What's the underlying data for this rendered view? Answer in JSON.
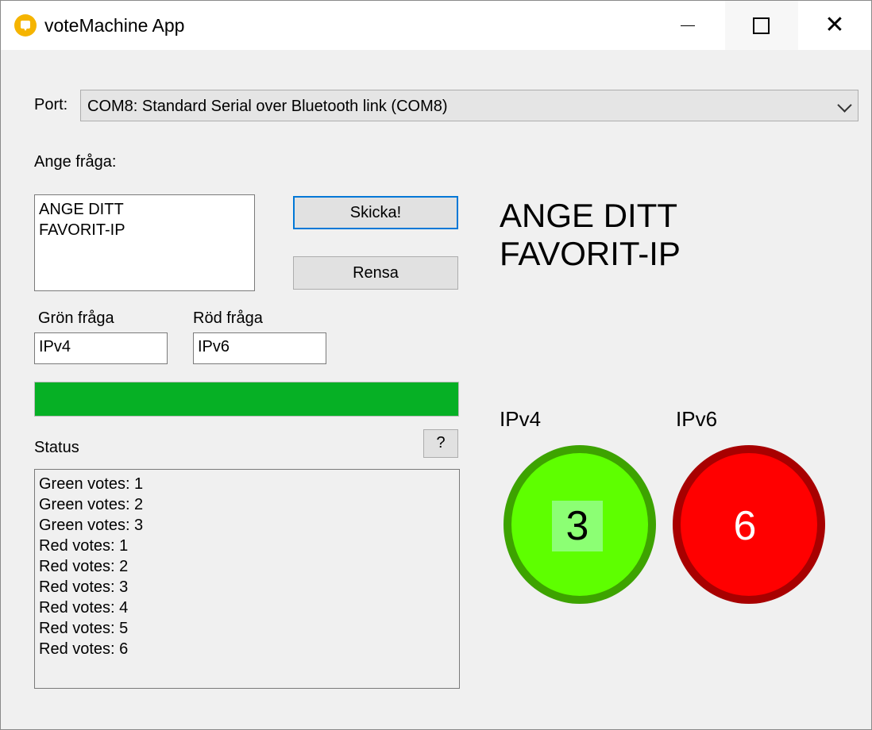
{
  "window": {
    "title": "voteMachine App",
    "close_glyph": "✕"
  },
  "port": {
    "label": "Port:",
    "selected": "COM8: Standard Serial over Bluetooth link (COM8)"
  },
  "question": {
    "label": "Ange fråga:",
    "value": "ANGE DITT\nFAVORIT-IP",
    "send_label": "Skicka!",
    "clear_label": "Rensa"
  },
  "green": {
    "label": "Grön fråga",
    "value": "IPv4"
  },
  "red": {
    "label": "Röd fråga",
    "value": "IPv6"
  },
  "progress": {
    "fraction": 1.0,
    "color": "#06b025"
  },
  "status": {
    "label": "Status",
    "help_label": "?",
    "lines": [
      "Green votes: 1",
      "Green votes: 2",
      "Green votes: 3",
      "Red votes: 1",
      "Red votes: 2",
      "Red votes: 3",
      "Red votes: 4",
      "Red votes: 5",
      "Red votes: 6"
    ]
  },
  "display": {
    "question_line1": "ANGE DITT",
    "question_line2": "FAVORIT-IP",
    "green_label": "IPv4",
    "red_label": "IPv6",
    "green_count": "3",
    "red_count": "6",
    "green_color": "#5eff00",
    "red_color": "#ff0000"
  }
}
